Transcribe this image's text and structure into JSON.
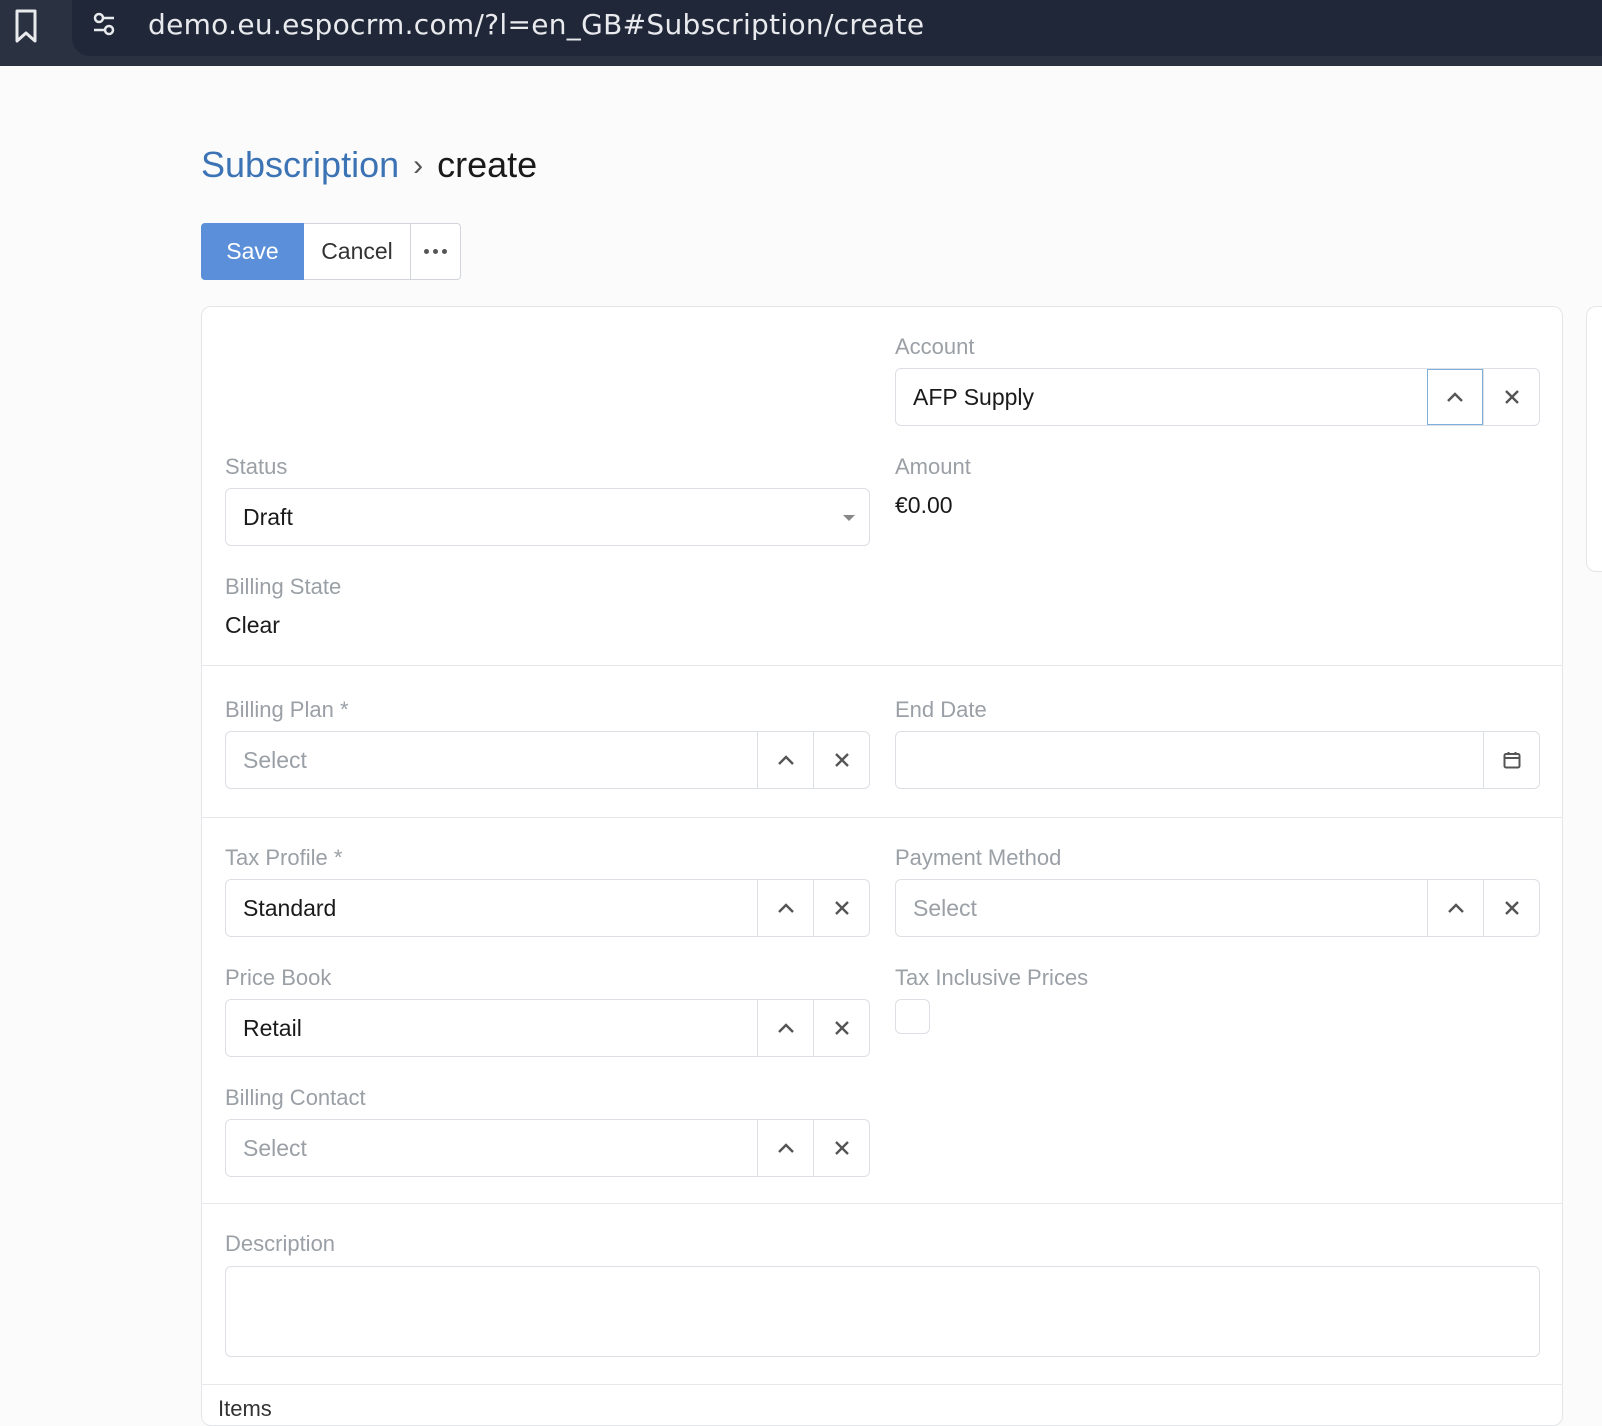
{
  "browser": {
    "url": "demo.eu.espocrm.com/?l=en_GB#Subscription/create",
    "icons": [
      "bookmark-icon",
      "tune-icon"
    ]
  },
  "breadcrumb": {
    "entity": "Subscription",
    "separator": "›",
    "current": "create"
  },
  "toolbar": {
    "save_label": "Save",
    "cancel_label": "Cancel"
  },
  "form": {
    "account": {
      "label": "Account",
      "value": "AFP Supply"
    },
    "status": {
      "label": "Status",
      "value": "Draft"
    },
    "amount": {
      "label": "Amount",
      "value": "€0.00"
    },
    "billing_state": {
      "label": "Billing State",
      "value": "Clear"
    },
    "billing_plan": {
      "label": "Billing Plan *",
      "placeholder": "Select"
    },
    "end_date": {
      "label": "End Date",
      "value": ""
    },
    "tax_profile": {
      "label": "Tax Profile *",
      "value": "Standard"
    },
    "payment_method": {
      "label": "Payment Method",
      "placeholder": "Select"
    },
    "price_book": {
      "label": "Price Book",
      "value": "Retail"
    },
    "tax_inclusive_prices": {
      "label": "Tax Inclusive Prices",
      "checked": false
    },
    "billing_contact": {
      "label": "Billing Contact",
      "placeholder": "Select"
    },
    "description": {
      "label": "Description",
      "value": ""
    },
    "items": {
      "label": "Items"
    }
  },
  "colors": {
    "primary": "#5b8fd9",
    "link": "#3c73b5",
    "topbar": "#2a3140"
  }
}
